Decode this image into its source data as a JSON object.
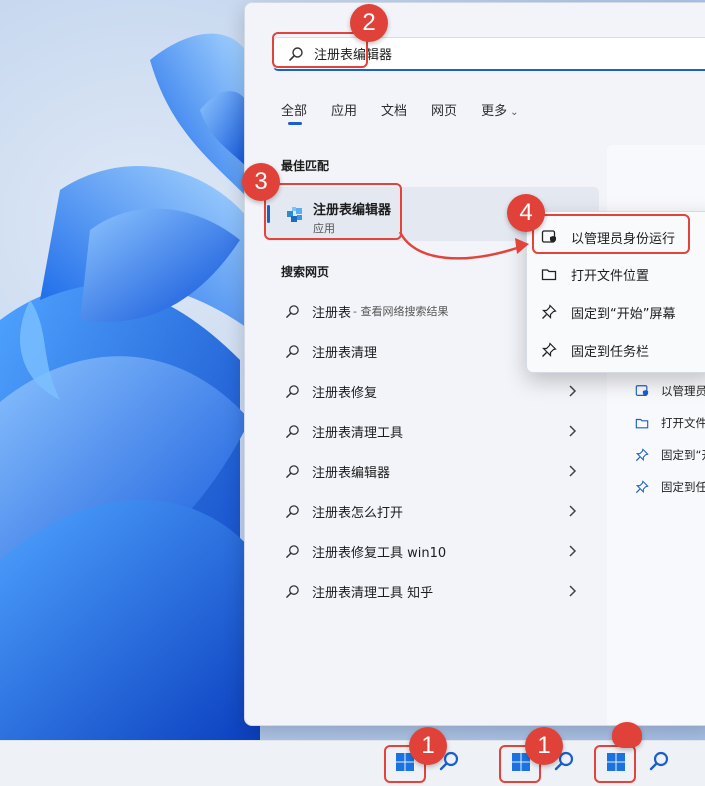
{
  "search": {
    "value": "注册表编辑器"
  },
  "tabs": [
    {
      "label": "全部"
    },
    {
      "label": "应用"
    },
    {
      "label": "文档"
    },
    {
      "label": "网页"
    },
    {
      "label": "更多"
    }
  ],
  "best_match": {
    "section_title": "最佳匹配",
    "title": "注册表编辑器",
    "subtitle": "应用"
  },
  "web_search": {
    "section_title": "搜索网页",
    "results": [
      {
        "label": "注册表",
        "suffix": " - 查看网络搜索结果"
      },
      {
        "label": "注册表清理",
        "suffix": ""
      },
      {
        "label": "注册表修复",
        "suffix": ""
      },
      {
        "label": "注册表清理工具",
        "suffix": ""
      },
      {
        "label": "注册表编辑器",
        "suffix": ""
      },
      {
        "label": "注册表怎么打开",
        "suffix": ""
      },
      {
        "label": "注册表修复工具 win10",
        "suffix": ""
      },
      {
        "label": "注册表清理工具 知乎",
        "suffix": ""
      }
    ]
  },
  "context_menu": {
    "items": [
      {
        "label": "以管理员身份运行",
        "icon": "shield-window-icon"
      },
      {
        "label": "打开文件位置",
        "icon": "folder-icon"
      },
      {
        "label": "固定到“开始”屏幕",
        "icon": "pin-icon"
      },
      {
        "label": "固定到任务栏",
        "icon": "pin-icon"
      }
    ]
  },
  "right_pane": {
    "items": [
      {
        "label": "以管理员",
        "icon": "shield-window-icon"
      },
      {
        "label": "打开文件",
        "icon": "folder-icon"
      },
      {
        "label": "固定到“开",
        "icon": "pin-icon"
      },
      {
        "label": "固定到任",
        "icon": "pin-icon"
      }
    ]
  },
  "annotations": {
    "step1": "1",
    "step2": "2",
    "step3": "3",
    "step4": "4",
    "color": "#e2433b"
  },
  "colors": {
    "accent": "#1a5fc9",
    "annotation_red": "#e2433b",
    "panel_bg": "#f2f4f9"
  }
}
